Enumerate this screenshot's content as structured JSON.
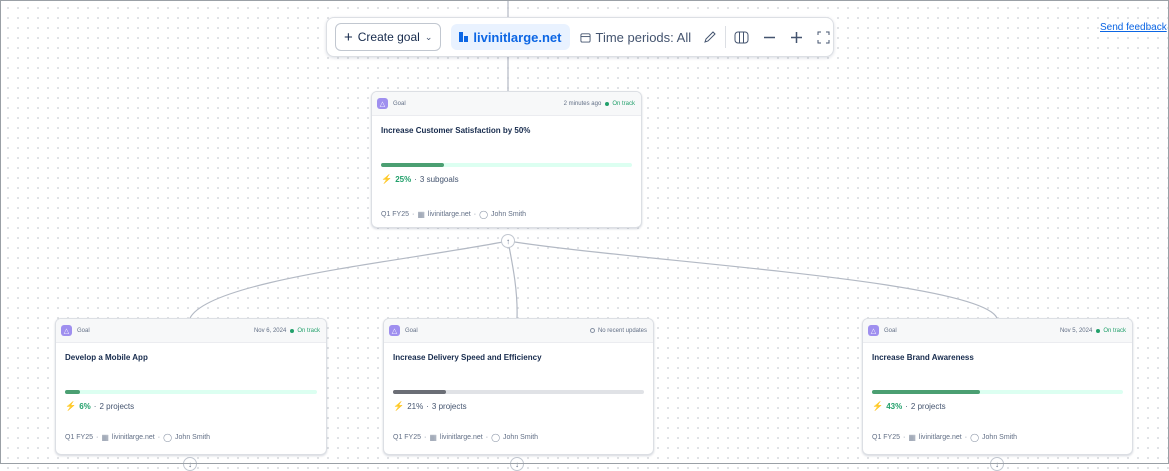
{
  "toolbar": {
    "create_label": "Create goal",
    "site_label": "livinitlarge.net",
    "time_periods_label": "Time periods: All",
    "icons": [
      "pen-icon",
      "map-icon",
      "zoom-out-icon",
      "zoom-in-icon",
      "fullscreen-icon"
    ]
  },
  "feedback_label": "Send feedback",
  "colors": {
    "on_track": "#22a06b",
    "bar_green": "#4b9f72",
    "bar_grey": "#6b6e76",
    "link": "#0c66e4",
    "goal_badge": "#9f8fef"
  },
  "cards": [
    {
      "type": "Goal",
      "time": "2 minutes ago",
      "status": "On track",
      "title": "Increase Customer Satisfaction by 50%",
      "progress": 25,
      "progress_label": "25%",
      "sub_label": "3 subgoals",
      "period": "Q1 FY25",
      "site": "livinitlarge.net",
      "owner": "John Smith"
    },
    {
      "type": "Goal",
      "time": "Nov 6, 2024",
      "status": "On track",
      "title": "Develop a Mobile App",
      "progress": 6,
      "progress_label": "6%",
      "sub_label": "2 projects",
      "period": "Q1 FY25",
      "site": "livinitlarge.net",
      "owner": "John Smith"
    },
    {
      "type": "Goal",
      "time": "",
      "status": "No recent updates",
      "title": "Increase Delivery Speed and Efficiency",
      "progress": 21,
      "progress_label": "21%",
      "sub_label": "3 projects",
      "period": "Q1 FY25",
      "site": "livinitlarge.net",
      "owner": "John Smith"
    },
    {
      "type": "Goal",
      "time": "Nov 5, 2024",
      "status": "On track",
      "title": "Increase Brand Awareness",
      "progress": 43,
      "progress_label": "43%",
      "sub_label": "2 projects",
      "period": "Q1 FY25",
      "site": "livinitlarge.net",
      "owner": "John Smith"
    }
  ]
}
